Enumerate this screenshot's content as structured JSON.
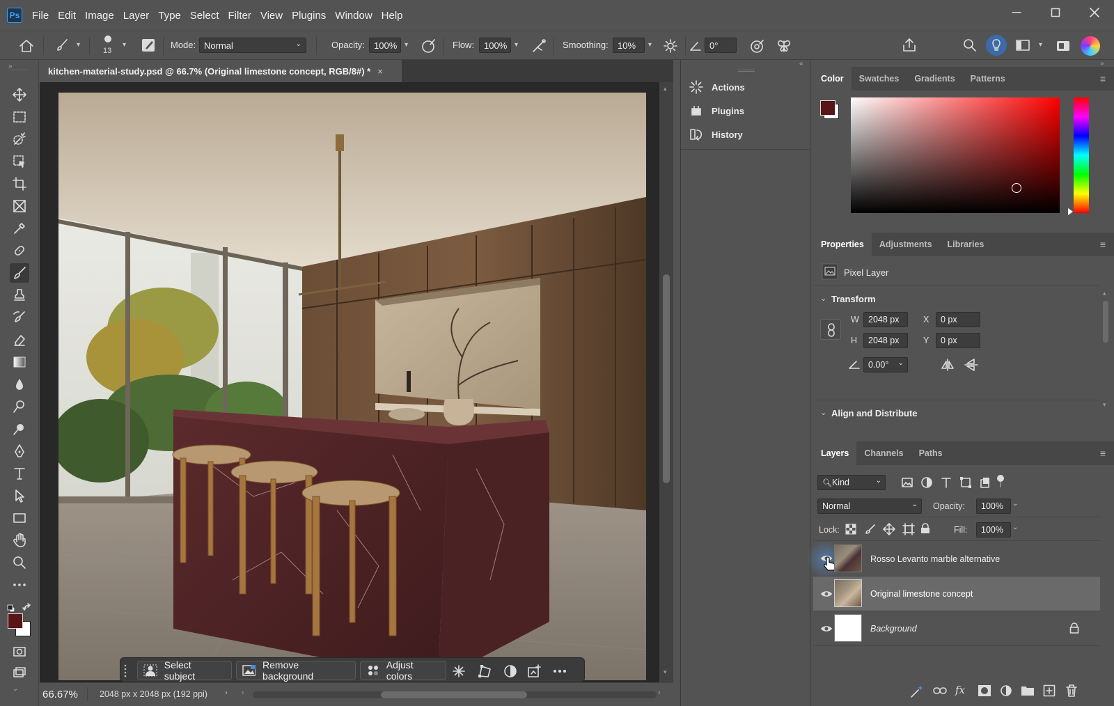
{
  "app": {
    "logo": "Ps"
  },
  "menu": [
    "File",
    "Edit",
    "Image",
    "Layer",
    "Type",
    "Select",
    "Filter",
    "View",
    "Plugins",
    "Window",
    "Help"
  ],
  "options": {
    "brush_size": "13",
    "mode_label": "Mode:",
    "mode_value": "Normal",
    "opacity_label": "Opacity:",
    "opacity_value": "100%",
    "flow_label": "Flow:",
    "flow_value": "100%",
    "smoothing_label": "Smoothing:",
    "smoothing_value": "10%",
    "angle_value": "0°"
  },
  "document": {
    "tab_title": "kitchen-material-study.psd @ 66.7% (Original limestone concept, RGB/8#) *",
    "close_glyph": "×",
    "zoom": "66.67%",
    "dimensions": "2048 px x 2048 px (192 ppi)"
  },
  "taskbar": {
    "select_subject": "Select subject",
    "remove_background": "Remove background",
    "adjust_colors": "Adjust colors"
  },
  "mid_panel": [
    "Actions",
    "Plugins",
    "History"
  ],
  "color_panel": {
    "tabs": [
      "Color",
      "Swatches",
      "Gradients",
      "Patterns"
    ],
    "foreground": "#5a1518",
    "background": "#ffffff",
    "hue": "#ff0000"
  },
  "properties_panel": {
    "tabs": [
      "Properties",
      "Adjustments",
      "Libraries"
    ],
    "layer_type": "Pixel Layer",
    "transform_title": "Transform",
    "w_label": "W",
    "w_value": "2048 px",
    "h_label": "H",
    "h_value": "2048 px",
    "x_label": "X",
    "x_value": "0 px",
    "y_label": "Y",
    "y_value": "0 px",
    "angle_value": "0.00°",
    "align_title": "Align and Distribute"
  },
  "layers_panel": {
    "tabs": [
      "Layers",
      "Channels",
      "Paths"
    ],
    "filter_kind": "Kind",
    "blend_mode": "Normal",
    "opacity_label": "Opacity:",
    "opacity_value": "100%",
    "lock_label": "Lock:",
    "fill_label": "Fill:",
    "fill_value": "100%",
    "layers": [
      {
        "name": "Rosso Levanto marble alternative"
      },
      {
        "name": "Original limestone concept"
      },
      {
        "name": "Background"
      }
    ]
  }
}
